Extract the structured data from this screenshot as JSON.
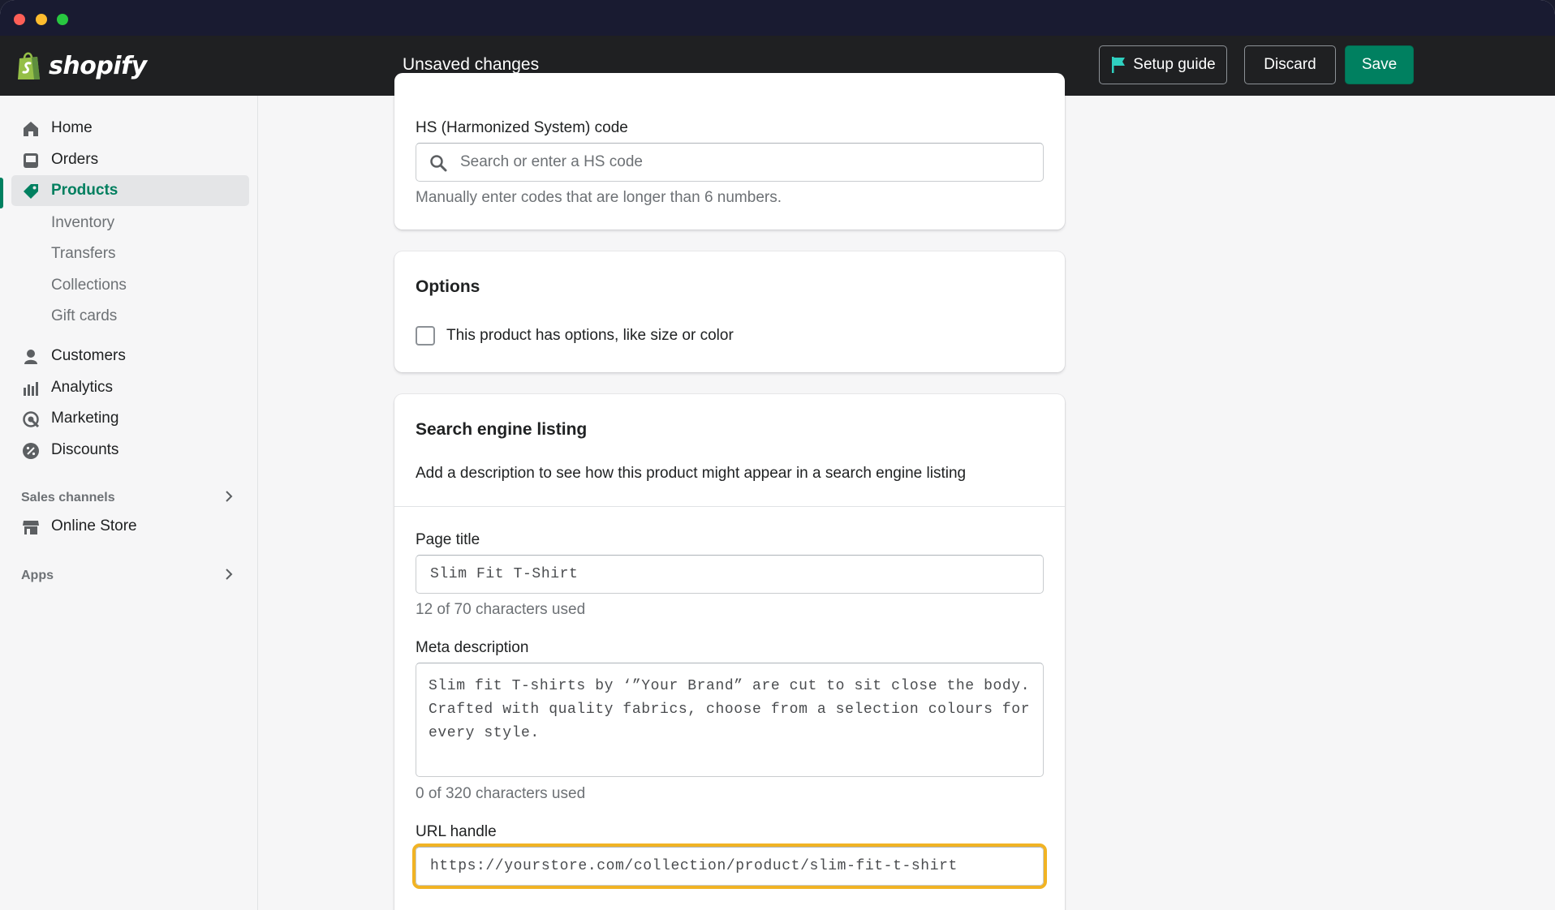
{
  "app": {
    "brand": "shopify",
    "status": "Unsaved changes"
  },
  "header": {
    "setup_label": "Setup guide",
    "discard_label": "Discard",
    "save_label": "Save"
  },
  "sidebar": {
    "items": [
      {
        "label": "Home",
        "icon": "home-icon"
      },
      {
        "label": "Orders",
        "icon": "orders-icon"
      },
      {
        "label": "Products",
        "icon": "tag-icon",
        "active": true
      },
      {
        "label": "Customers",
        "icon": "person-icon"
      },
      {
        "label": "Analytics",
        "icon": "bar-chart-icon"
      },
      {
        "label": "Marketing",
        "icon": "target-icon"
      },
      {
        "label": "Discounts",
        "icon": "discount-icon"
      }
    ],
    "product_subitems": [
      "Inventory",
      "Transfers",
      "Collections",
      "Gift cards"
    ],
    "sales_channels": {
      "heading": "Sales channels",
      "items": [
        {
          "label": "Online Store",
          "icon": "store-icon"
        }
      ]
    },
    "apps_heading": "Apps"
  },
  "hs_card": {
    "label": "HS (Harmonized System) code",
    "placeholder": "Search or enter a HS code",
    "help": "Manually enter codes that are longer than 6 numbers."
  },
  "options_card": {
    "title": "Options",
    "checkbox_label": "This product has options, like size or color",
    "checked": false
  },
  "seo_card": {
    "title": "Search engine listing",
    "description": "Add a description to see how this product might appear in a search engine listing",
    "page_title_label": "Page title",
    "page_title_value": "Slim Fit T-Shirt",
    "page_title_count": "12 of 70 characters used",
    "meta_label": "Meta description",
    "meta_value": "Slim fit T-shirts by ‘”Your Brand” are cut to sit close the body. Crafted with quality fabrics, choose from a selection colours for every style.",
    "meta_count": "0 of 320 characters used",
    "url_label": "URL handle",
    "url_value": "https://yourstore.com/collection/product/slim-fit-t-shirt"
  },
  "colors": {
    "accent": "#008060",
    "focus": "#f1b324",
    "topbar": "#1f2022"
  }
}
